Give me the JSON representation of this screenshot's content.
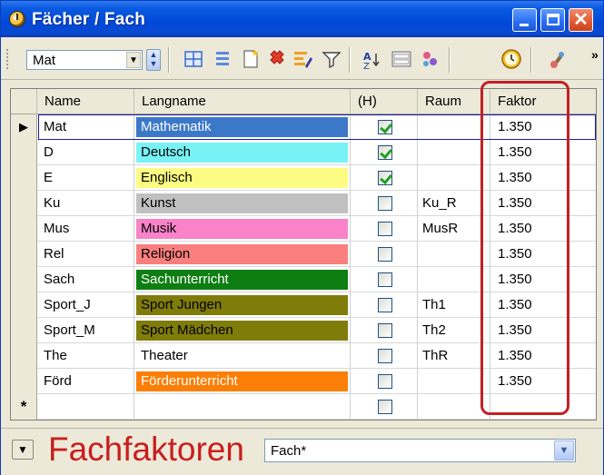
{
  "window": {
    "title": "Fächer / Fach"
  },
  "toolbar": {
    "combo_value": "Mat",
    "icons": [
      "grid-icon",
      "list-icon",
      "new-icon",
      "delete-icon",
      "edit-icon",
      "filter-icon",
      "sort-icon",
      "columns-icon",
      "link-icon",
      "clock-icon",
      "settings-icon"
    ]
  },
  "grid": {
    "columns": [
      "Name",
      "Langname",
      "(H)",
      "Raum",
      "Faktor"
    ],
    "rows": [
      {
        "name": "Mat",
        "langname": "Mathematik",
        "h": true,
        "raum": "",
        "faktor": "1.350",
        "color": "#3c78c8",
        "text_color": "#ffffff"
      },
      {
        "name": "D",
        "langname": "Deutsch",
        "h": true,
        "raum": "",
        "faktor": "1.350",
        "color": "#79f2f6",
        "text_color": "#000000"
      },
      {
        "name": "E",
        "langname": "Englisch",
        "h": true,
        "raum": "",
        "faktor": "1.350",
        "color": "#fcfc82",
        "text_color": "#000000"
      },
      {
        "name": "Ku",
        "langname": "Kunst",
        "h": false,
        "raum": "Ku_R",
        "faktor": "1.350",
        "color": "#c0c0c0",
        "text_color": "#000000"
      },
      {
        "name": "Mus",
        "langname": "Musik",
        "h": false,
        "raum": "MusR",
        "faktor": "1.350",
        "color": "#f982c8",
        "text_color": "#000000"
      },
      {
        "name": "Rel",
        "langname": "Religion",
        "h": false,
        "raum": "",
        "faktor": "1.350",
        "color": "#fa7f7f",
        "text_color": "#000000"
      },
      {
        "name": "Sach",
        "langname": "Sachunterricht",
        "h": false,
        "raum": "",
        "faktor": "1.350",
        "color": "#0e7e12",
        "text_color": "#ffffff"
      },
      {
        "name": "Sport_J",
        "langname": "Sport Jungen",
        "h": false,
        "raum": "Th1",
        "faktor": "1.350",
        "color": "#807c0a",
        "text_color": "#000000"
      },
      {
        "name": "Sport_M",
        "langname": "Sport Mädchen",
        "h": false,
        "raum": "Th2",
        "faktor": "1.350",
        "color": "#807c0a",
        "text_color": "#000000"
      },
      {
        "name": "The",
        "langname": "Theater",
        "h": false,
        "raum": "ThR",
        "faktor": "1.350",
        "color": "#ffffff",
        "text_color": "#000000"
      },
      {
        "name": "Förd",
        "langname": "Förderunterricht",
        "h": false,
        "raum": "",
        "faktor": "1.350",
        "color": "#fb7f06",
        "text_color": "#ffffff"
      }
    ],
    "new_row_marker": "*",
    "current_row_marker": "▶"
  },
  "bottom": {
    "label": "Fachfaktoren",
    "select_value": "Fach*"
  },
  "colors": {
    "accent": "#0048d8",
    "highlight": "#c32024"
  }
}
